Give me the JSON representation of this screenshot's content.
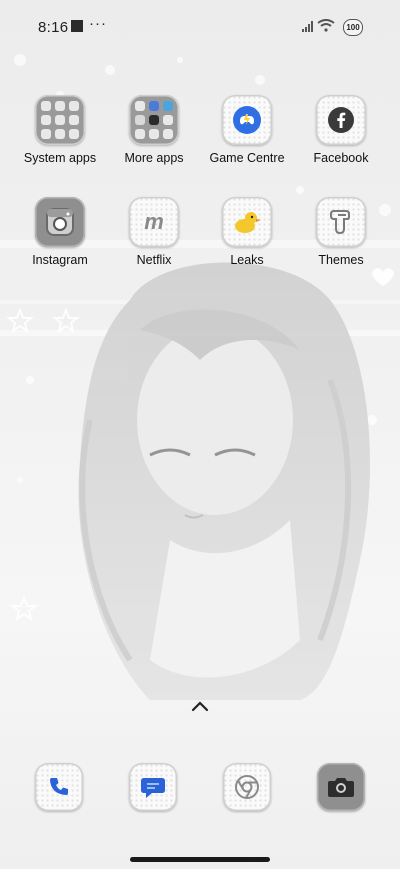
{
  "status_bar": {
    "time": "8:16",
    "more_indicator": "···",
    "battery": "100",
    "icons": [
      "notification-square-icon",
      "signal-icon",
      "wifi-icon",
      "battery-icon"
    ]
  },
  "home": {
    "row1": [
      {
        "label": "System apps",
        "icon": "folder-icon"
      },
      {
        "label": "More apps",
        "icon": "folder-icon"
      },
      {
        "label": "Game Centre",
        "icon": "game-controller-icon"
      },
      {
        "label": "Facebook",
        "icon": "facebook-icon"
      }
    ],
    "row2": [
      {
        "label": "Instagram",
        "icon": "instagram-icon"
      },
      {
        "label": "Netflix",
        "icon": "netflix-icon"
      },
      {
        "label": "Leaks",
        "icon": "duck-icon"
      },
      {
        "label": "Themes",
        "icon": "themes-icon"
      }
    ]
  },
  "dock": [
    {
      "icon": "phone-icon"
    },
    {
      "icon": "messages-icon"
    },
    {
      "icon": "chrome-icon"
    },
    {
      "icon": "camera-icon"
    }
  ],
  "app_drawer_hint": "chevron-up-icon",
  "colors": {
    "game_centre": "#2f6fe3",
    "leaks_duck": "#f4c82b",
    "facebook": "#3a3a3a",
    "phone": "#2a62d8",
    "messages": "#2a62d8"
  }
}
